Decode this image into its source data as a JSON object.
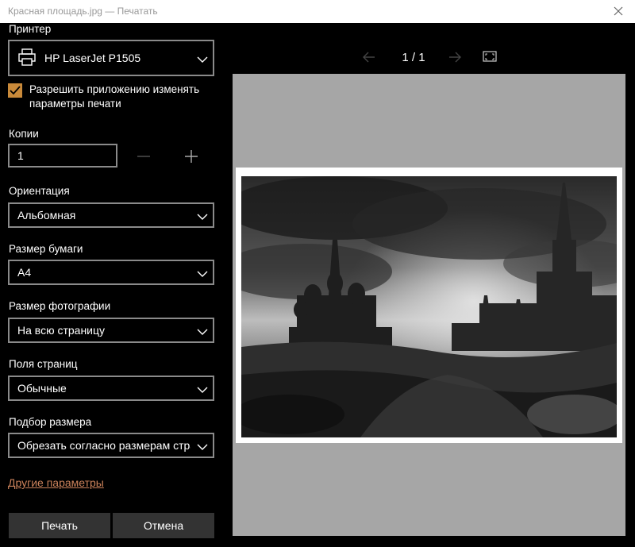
{
  "window": {
    "title": "Красная площадь.jpg — Печатать"
  },
  "printer": {
    "label": "Принтер",
    "value": "HP LaserJet P1505"
  },
  "allow_change": {
    "text": "Разрешить приложению изменять параметры печати",
    "checked": true
  },
  "copies": {
    "label": "Копии",
    "value": "1"
  },
  "orientation": {
    "label": "Ориентация",
    "value": "Альбомная"
  },
  "paper_size": {
    "label": "Размер бумаги",
    "value": "A4"
  },
  "photo_size": {
    "label": "Размер фотографии",
    "value": "На всю страницу"
  },
  "margins": {
    "label": "Поля страниц",
    "value": "Обычные"
  },
  "fit": {
    "label": "Подбор размера",
    "value": "Обрезать согласно размерам стра"
  },
  "more_settings": "Другие параметры",
  "buttons": {
    "print": "Печать",
    "cancel": "Отмена"
  },
  "pager": {
    "current": "1",
    "sep": "/",
    "total": "1"
  },
  "colors": {
    "accent": "#c98a3a",
    "link": "#c9815a",
    "preview_bg": "#a6a6a6"
  },
  "icons": [
    "close-icon",
    "printer-icon",
    "chevron-down-icon",
    "checkmark-icon",
    "minus-icon",
    "plus-icon",
    "arrow-left-icon",
    "arrow-right-icon",
    "fullscreen-icon"
  ]
}
